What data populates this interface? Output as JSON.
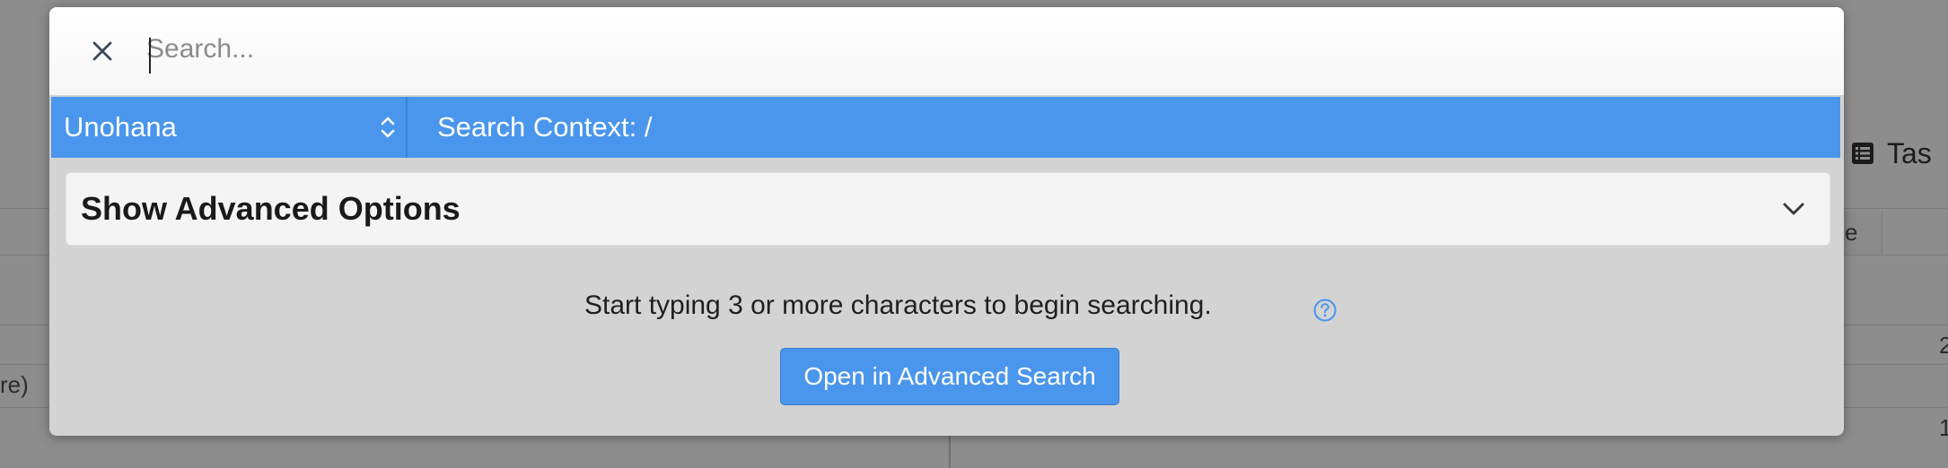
{
  "search": {
    "placeholder": "Search...",
    "value": ""
  },
  "context": {
    "namespace": "Unohana",
    "label": "Search Context: /"
  },
  "advanced_options": {
    "label": "Show Advanced Options"
  },
  "hint": {
    "text": "Start typing 3 or more characters to begin searching."
  },
  "actions": {
    "open_advanced_search": "Open in Advanced Search"
  },
  "background": {
    "tab_label": "Tas",
    "row_text_1": "re)",
    "header_fragment": "e",
    "right_num_1": "2",
    "right_num_2": "1"
  },
  "colors": {
    "accent": "#4a96ec",
    "modal_bg": "#d3d3d3",
    "panel_bg": "#f4f4f4"
  },
  "icons": {
    "close": "close-icon",
    "select_caret": "up-down-chevron-icon",
    "expand": "chevron-down-icon",
    "help": "question-circle-icon",
    "tasks": "list-icon"
  }
}
